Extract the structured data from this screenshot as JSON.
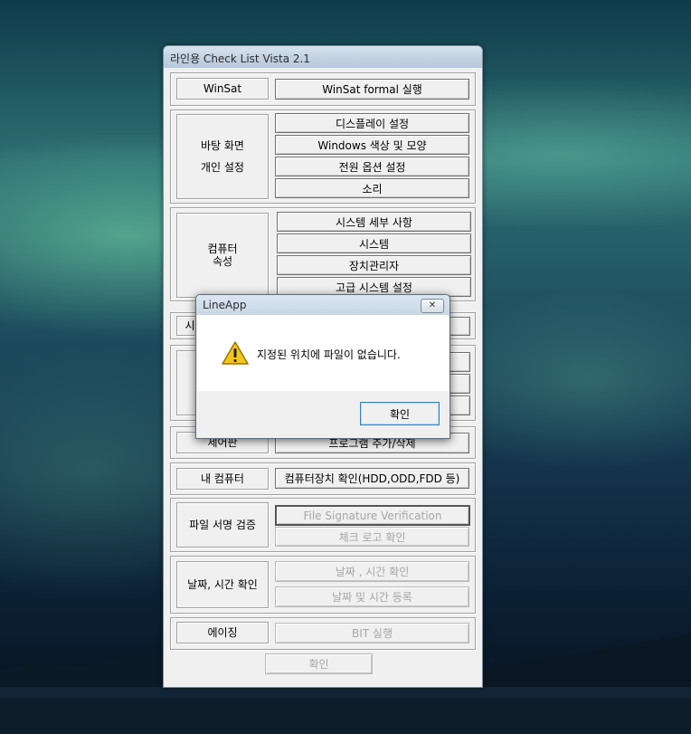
{
  "window": {
    "title": "라인용 Check List Vista 2.1",
    "winsat": {
      "label": "WinSat",
      "button": "WinSat formal 실행"
    },
    "desktop": {
      "label_line1": "바탕 화면",
      "label_line2": "개인 설정",
      "buttons": [
        "디스플레이 설정",
        "Windows 색상 및 모양",
        "전원 옵션 설정",
        "소리"
      ]
    },
    "computer_props": {
      "label_line1": "컴퓨터",
      "label_line2": "속성",
      "buttons": [
        "시스템 세부 사항",
        "시스템",
        "장치관리자",
        "고급 시스템 설정"
      ]
    },
    "partial_label_a": "시",
    "control_panel": {
      "label": "제어판",
      "button": "프로그램 추가/삭제"
    },
    "my_computer": {
      "label": "내 컴퓨터",
      "button": "컴퓨터장치 확인(HDD,ODD,FDD 등)"
    },
    "file_sig": {
      "label": "파일 서명 검증",
      "buttons": [
        "File Signature Verification",
        "체크 로고 확인"
      ]
    },
    "datetime": {
      "label": "날짜, 시간 확인",
      "buttons": [
        "날짜 , 시간 확인",
        "날짜 및 시간 등록"
      ]
    },
    "aging": {
      "label": "에이징",
      "button": "BIT 실행"
    },
    "ok": "확인"
  },
  "dialog": {
    "title": "LineApp",
    "close": "✕",
    "icon": "warning-icon",
    "message": "지정된 위치에 파일이 없습니다.",
    "ok": "확인"
  }
}
